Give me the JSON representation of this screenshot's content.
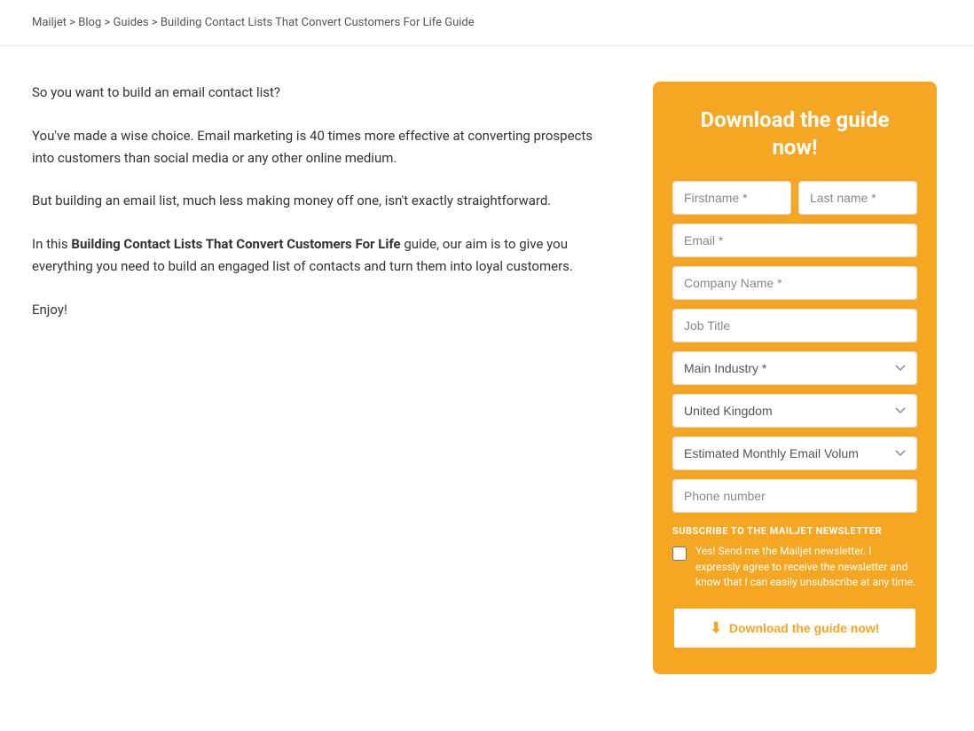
{
  "breadcrumb": {
    "items": [
      "Mailjet",
      "Blog",
      "Guides",
      "Building Contact Lists That Convert Customers For Life Guide"
    ],
    "separators": [
      ">",
      ">",
      ">"
    ]
  },
  "main": {
    "paragraph1": "So you want to build an email contact list?",
    "paragraph2": "You've made a wise choice. Email marketing is 40 times more effective at converting prospects into customers than social media or any other online medium.",
    "paragraph3_prefix": "But building an email list, much less making money off one, isn't exactly straightforward.",
    "paragraph4_prefix": "In this ",
    "paragraph4_bold": "Building Contact Lists That Convert Customers For Life",
    "paragraph4_suffix": " guide, our aim is to give you everything you need to build an engaged list of contacts and turn them into loyal customers.",
    "paragraph5": "Enjoy!"
  },
  "sidebar": {
    "title": "Download the guide\nnow!",
    "form": {
      "firstname_placeholder": "Firstname *",
      "lastname_placeholder": "Last name *",
      "email_placeholder": "Email *",
      "company_placeholder": "Company Name *",
      "job_placeholder": "Job Title",
      "industry_placeholder": "Main Industry *",
      "country_placeholder": "United Kingdom",
      "volume_placeholder": "Estimated Monthly Email Volum",
      "phone_placeholder": "Phone number"
    },
    "newsletter": {
      "label": "SUBSCRIBE TO THE MAILJET NEWSLETTER",
      "checkbox_text": "Yes! Send me the Mailjet newsletter. I expressly agree to receive the newsletter and know that I can easily unsubscribe at any time."
    },
    "button_label": "Download the guide now!",
    "button_icon": "⬇"
  }
}
